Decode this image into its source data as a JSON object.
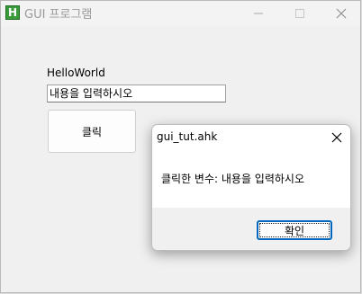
{
  "window": {
    "title": "GUI 프로그램",
    "icon_letter": "H",
    "icon_name": "autohotkey-icon",
    "controls": [
      "minimize-icon",
      "maximize-icon",
      "close-icon"
    ]
  },
  "main": {
    "label": "HelloWorld",
    "input_value": "내용을 입력하시오",
    "button_label": "클릭"
  },
  "msgbox": {
    "title": "gui_tut.ahk",
    "message": "클릭한 변수: 내용을 입력하시오",
    "ok_label": "확인"
  },
  "colors": {
    "accent": "#0067c0",
    "icon_green": "#3a9b3a"
  }
}
